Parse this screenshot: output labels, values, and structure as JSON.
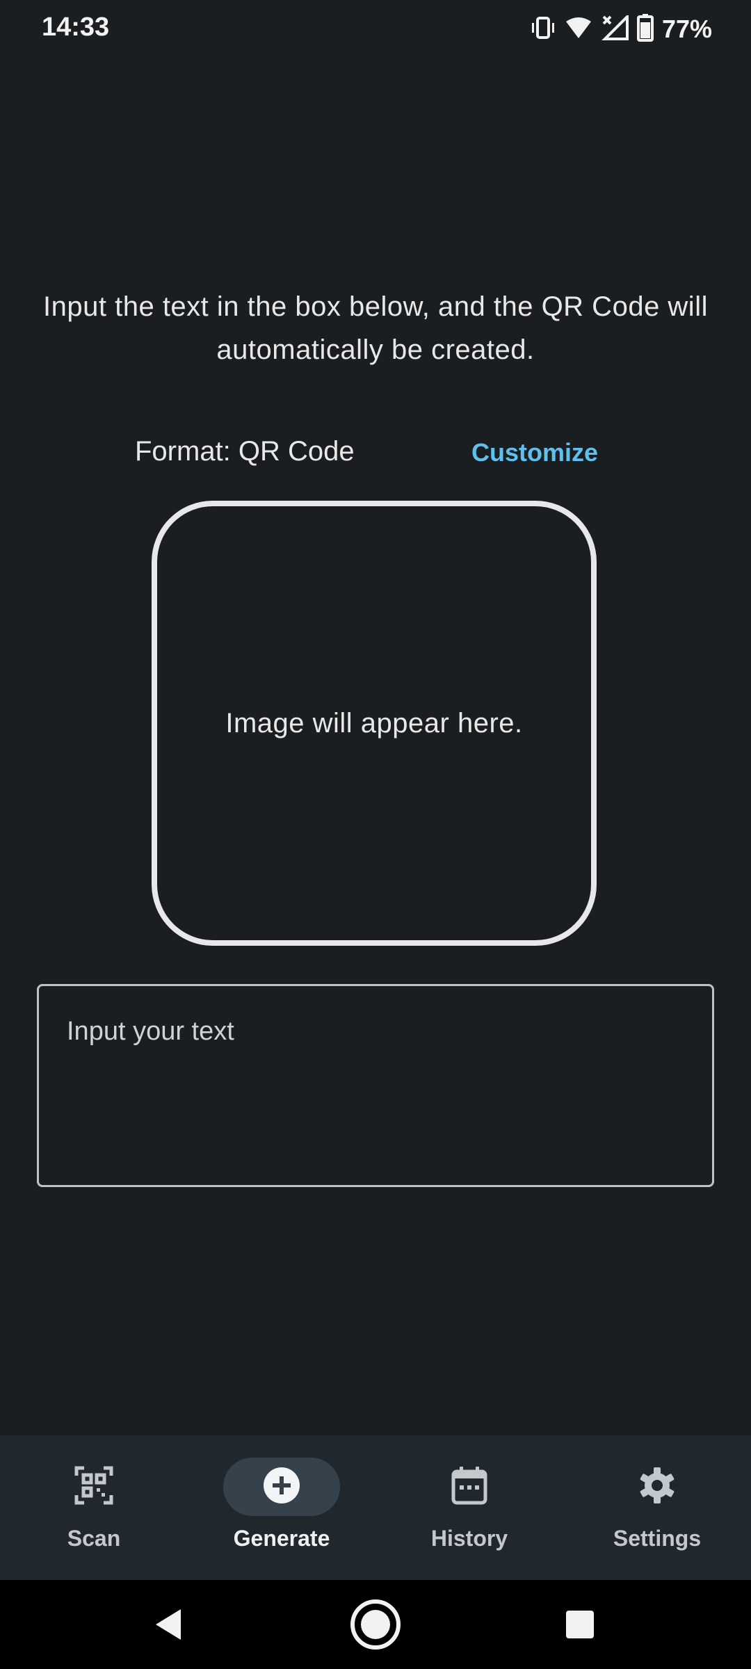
{
  "status_bar": {
    "time": "14:33",
    "battery_percent": "77%",
    "icons": [
      "vibrate-icon",
      "wifi-icon",
      "cell-signal-icon",
      "battery-icon"
    ]
  },
  "main": {
    "instructions": "Input the text in the box below, and the QR Code will automatically be created.",
    "format_label": "Format: QR Code",
    "customize_label": "Customize",
    "image_placeholder": "Image will appear here.",
    "input_placeholder": "Input your text",
    "input_value": ""
  },
  "bottom_nav": {
    "items": [
      {
        "label": "Scan",
        "icon": "qr-scan-icon",
        "active": false
      },
      {
        "label": "Generate",
        "icon": "add-circle-icon",
        "active": true
      },
      {
        "label": "History",
        "icon": "calendar-icon",
        "active": false
      },
      {
        "label": "Settings",
        "icon": "gear-icon",
        "active": false
      }
    ]
  },
  "colors": {
    "background": "#1b1e21",
    "accent_link": "#5fc0ee",
    "nav_background": "#20272d",
    "nav_active_pill": "#36424b"
  }
}
